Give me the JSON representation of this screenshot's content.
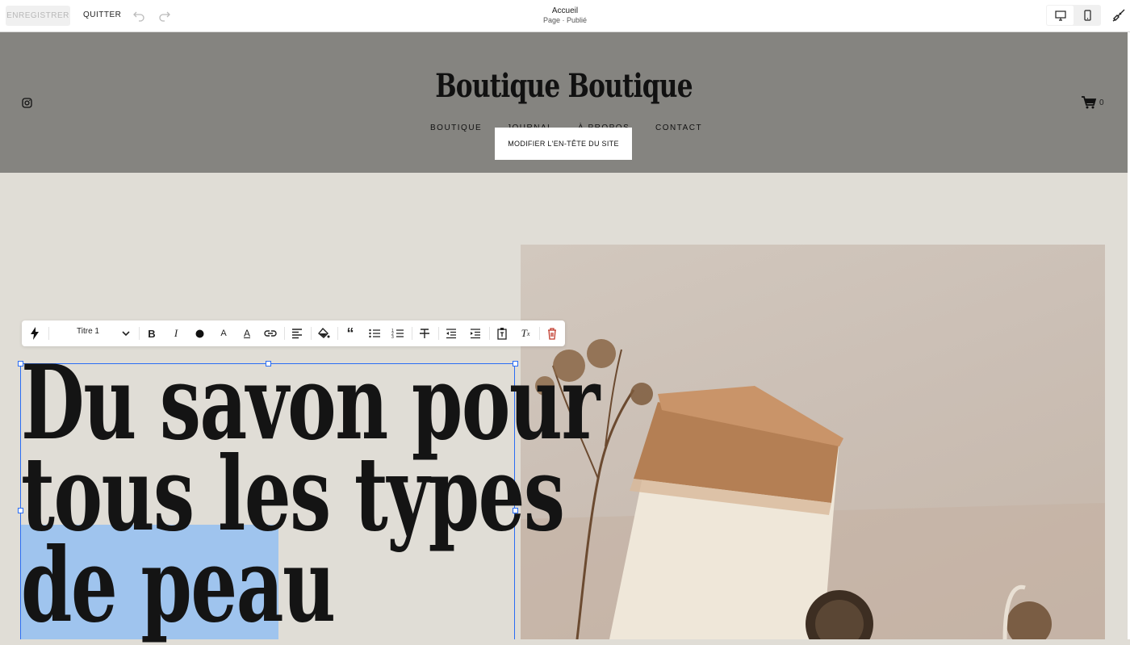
{
  "editor_bar": {
    "save_label": "ENREGISTRER",
    "quit_label": "QUITTER",
    "page_title": "Accueil",
    "page_status": "Page · Publié"
  },
  "site_header": {
    "brand": "Boutique Boutique",
    "nav": [
      "BOUTIQUE",
      "JOURNAL",
      "À PROPOS",
      "CONTACT"
    ],
    "cart_count": "0",
    "edit_header_label": "MODIFIER L'EN-TÊTE DU SITE"
  },
  "toolbar": {
    "style_select": "Titre 1",
    "icons": [
      "lightning-icon",
      "bold-icon",
      "italic-icon",
      "color-dot-icon",
      "text-size-icon",
      "text-highlight-icon",
      "link-icon",
      "align-left-icon",
      "paint-bucket-icon",
      "quote-icon",
      "bullet-list-icon",
      "numbered-list-icon",
      "strikethrough-icon",
      "outdent-icon",
      "indent-icon",
      "paste-text-icon",
      "clear-format-icon",
      "trash-icon"
    ]
  },
  "heading": {
    "line1": "Du savon pour",
    "line2": "tous les types",
    "line3": "de peau"
  },
  "colors": {
    "header_bg": "#858480",
    "page_bg": "#e0ddd6",
    "selection": "#9fc4ee",
    "accent": "#2a6df4"
  }
}
